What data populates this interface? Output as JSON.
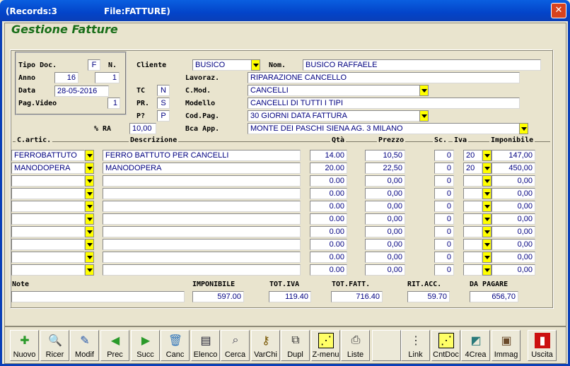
{
  "window": {
    "records": "(Records:3",
    "file": "File:FATTURE)"
  },
  "heading": "Gestione Fatture",
  "header": {
    "tipo_doc_label": "Tipo Doc.",
    "tipo_doc": "F",
    "n_label": "N.",
    "anno_label": "Anno",
    "anno": "16",
    "numero": "1",
    "data_label": "Data",
    "data": "28-05-2016",
    "pag_video_label": "Pag.Video",
    "pag_video": "1",
    "cliente_label": "Cliente",
    "cliente": "BUSICO",
    "nom_label": "Nom.",
    "nom": "BUSICO RAFFAELE",
    "lavoraz_label": "Lavoraz.",
    "lavoraz": "RIPARAZIONE CANCELLO",
    "tc_label": "TC",
    "tc": "N",
    "cmod_label": "C.Mod.",
    "cmod": "CANCELLI",
    "pr_label": "PR.",
    "pr": "S",
    "modello_label": "Modello",
    "modello": "CANCELLI DI TUTTI I TIPI",
    "p_label": "P?",
    "p": "P",
    "codpag_label": "Cod.Pag.",
    "codpag": "30 GIORNI DATA FATTURA",
    "ra_label": "% RA",
    "ra": "10,00",
    "bca_label": "Bca App.",
    "bca": "MONTE DEI PASCHI SIENA  AG. 3  MILANO"
  },
  "columns": {
    "cartic": "C.artic.",
    "descr": "Descrizione",
    "qta": "Qtà",
    "prezzo": "Prezzo",
    "sc": "Sc.",
    "iva": "Iva",
    "imponibile": "Imponibile"
  },
  "rows": [
    {
      "cartic": "FERROBATTUTO",
      "descr": "FERRO BATTUTO PER CANCELLI",
      "qta": "14.00",
      "prezzo": "10,50",
      "sc": "0",
      "iva": "20",
      "imp": "147,00"
    },
    {
      "cartic": "MANODOPERA",
      "descr": "MANODOPERA",
      "qta": "20.00",
      "prezzo": "22,50",
      "sc": "0",
      "iva": "20",
      "imp": "450,00"
    },
    {
      "cartic": "",
      "descr": "",
      "qta": "0.00",
      "prezzo": "0,00",
      "sc": "0",
      "iva": "",
      "imp": "0,00"
    },
    {
      "cartic": "",
      "descr": "",
      "qta": "0.00",
      "prezzo": "0,00",
      "sc": "0",
      "iva": "",
      "imp": "0,00"
    },
    {
      "cartic": "",
      "descr": "",
      "qta": "0.00",
      "prezzo": "0,00",
      "sc": "0",
      "iva": "",
      "imp": "0,00"
    },
    {
      "cartic": "",
      "descr": "",
      "qta": "0.00",
      "prezzo": "0,00",
      "sc": "0",
      "iva": "",
      "imp": "0,00"
    },
    {
      "cartic": "",
      "descr": "",
      "qta": "0.00",
      "prezzo": "0,00",
      "sc": "0",
      "iva": "",
      "imp": "0,00"
    },
    {
      "cartic": "",
      "descr": "",
      "qta": "0.00",
      "prezzo": "0,00",
      "sc": "0",
      "iva": "",
      "imp": "0,00"
    },
    {
      "cartic": "",
      "descr": "",
      "qta": "0.00",
      "prezzo": "0,00",
      "sc": "0",
      "iva": "",
      "imp": "0,00"
    },
    {
      "cartic": "",
      "descr": "",
      "qta": "0.00",
      "prezzo": "0,00",
      "sc": "0",
      "iva": "",
      "imp": "0,00"
    }
  ],
  "totals": {
    "note_label": "Note",
    "note": "",
    "imponibile_label": "IMPONIBILE",
    "imponibile": "597.00",
    "totiva_label": "TOT.IVA",
    "totiva": "119.40",
    "totfatt_label": "TOT.FATT.",
    "totfatt": "716.40",
    "ritacc_label": "RIT.ACC.",
    "ritacc": "59.70",
    "dapagare_label": "DA PAGARE",
    "dapagare": "656,70"
  },
  "toolbar": [
    {
      "label": "Nuovo",
      "icon": "new-doc-icon",
      "glyph": "✚",
      "color": "#2a9a2a"
    },
    {
      "label": "Ricer",
      "icon": "search-icon",
      "glyph": "🔍",
      "color": "#334"
    },
    {
      "label": "Modif",
      "icon": "edit-icon",
      "glyph": "✎",
      "color": "#2255aa"
    },
    {
      "label": "Prec",
      "icon": "arrow-left-icon",
      "glyph": "◀",
      "color": "#2a9a2a"
    },
    {
      "label": "Succ",
      "icon": "arrow-right-icon",
      "glyph": "▶",
      "color": "#2a9a2a"
    },
    {
      "label": "Canc",
      "icon": "trash-icon",
      "glyph": "🗑",
      "color": "#3377bb"
    },
    {
      "label": "Elenco",
      "icon": "list-icon",
      "glyph": "▤",
      "color": "#223"
    },
    {
      "label": "Cerca",
      "icon": "find-icon",
      "glyph": "⌕",
      "color": "#445"
    },
    {
      "label": "VarChi",
      "icon": "keys-icon",
      "glyph": "⚷",
      "color": "#775500"
    },
    {
      "label": "Dupl",
      "icon": "duplicate-icon",
      "glyph": "⧉",
      "color": "#333"
    },
    {
      "label": "Z-menu",
      "icon": "menu-icon",
      "glyph": "⋰",
      "color": "#000"
    },
    {
      "label": "Liste",
      "icon": "printer-icon",
      "glyph": "⎙",
      "color": "#333"
    },
    {
      "label": "",
      "icon": "blank-icon",
      "glyph": "",
      "color": "#000"
    },
    {
      "label": "Link",
      "icon": "link-icon",
      "glyph": "⋮",
      "color": "#333"
    },
    {
      "label": "CntDoc",
      "icon": "counter-icon",
      "glyph": "⋰",
      "color": "#000"
    },
    {
      "label": "4Crea",
      "icon": "create-icon",
      "glyph": "◩",
      "color": "#2a7a7a"
    },
    {
      "label": "Immag",
      "icon": "image-icon",
      "glyph": "▣",
      "color": "#6a4a2a"
    },
    {
      "label": "",
      "icon": "blank-icon",
      "glyph": "",
      "color": "#000"
    },
    {
      "label": "Uscita",
      "icon": "exit-door-icon",
      "glyph": "▮",
      "color": "#cc1010"
    }
  ]
}
